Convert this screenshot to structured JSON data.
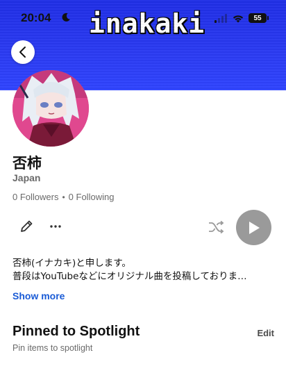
{
  "status_bar": {
    "time": "20:04",
    "battery": "55",
    "icons": [
      "moon-icon",
      "signal-icon",
      "wifi-icon",
      "battery-icon"
    ]
  },
  "banner": {
    "title": "inakaki",
    "color": "#2a3af2"
  },
  "header": {
    "back_icon": "chevron-left-icon"
  },
  "profile": {
    "name": "否柿",
    "location": "Japan",
    "followers": "0 Followers",
    "separator": "•",
    "following": "0 Following"
  },
  "actions": {
    "icons": [
      "edit-pencil-icon",
      "more-options-icon",
      "shuffle-icon",
      "play-icon"
    ],
    "play_button_color": "#9a9a9a"
  },
  "bio": {
    "line1": "否柿(イナカキ)と申します。",
    "line2": "普段はYouTubeなどにオリジナル曲を投稿しておりま…",
    "show_more": "Show more",
    "link_color": "#1a5bd6"
  },
  "spotlight": {
    "title": "Pinned to Spotlight",
    "edit": "Edit",
    "subtitle": "Pin items to spotlight"
  }
}
